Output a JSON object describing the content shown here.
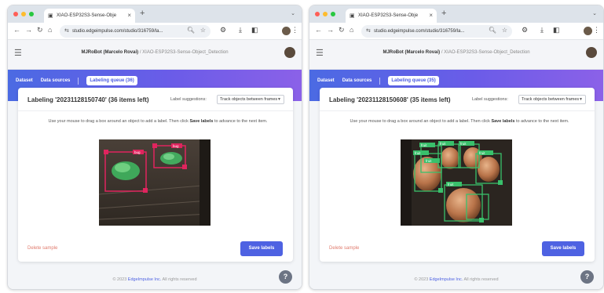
{
  "colors": {
    "brand_blue": "#4e62e2",
    "bbox_red": "#e0245e",
    "bbox_green": "#39c06b",
    "delete_text": "#e07b6d"
  },
  "windows": [
    {
      "tab": {
        "favicon": "edge-impulse-icon",
        "title": "XIAO-ESP32S3-Sense-Obje",
        "close": "×",
        "new_tab": "+"
      },
      "omnibox": {
        "url": "studio.edgeimpulse.com/studio/316759/la..."
      },
      "header": {
        "user": "MJRoBot (Marcelo Rovai)",
        "separator": "/",
        "project": "XIAO-ESP32S3-Sense-Object_Detection"
      },
      "nav": {
        "items": [
          {
            "label": "Dataset"
          },
          {
            "label": "Data sources"
          }
        ],
        "active": "Labeling queue (36)"
      },
      "card": {
        "title": "Labeling '20231128150740' (36 items left)",
        "suggestions_label": "Label suggestions:",
        "suggestions_value": "Track objects between frames",
        "instr_pre": "Use your mouse to drag a box around an object to add a label. Then click ",
        "instr_bold": "Save labels",
        "instr_post": " to advance to the next item.",
        "delete": "Delete sample",
        "save": "Save labels"
      },
      "image": {
        "labels": [
          "bug",
          "bug"
        ]
      },
      "footer": {
        "pre": "© 2023 ",
        "link": "EdgeImpulse Inc.",
        "post": " All rights reserved"
      },
      "help": "?"
    },
    {
      "tab": {
        "favicon": "edge-impulse-icon",
        "title": "XIAO-ESP32S3-Sense-Obje",
        "close": "×",
        "new_tab": "+"
      },
      "omnibox": {
        "url": "studio.edgeimpulse.com/studio/316759/la..."
      },
      "header": {
        "user": "MJRoBot (Marcelo Rovai)",
        "separator": "/",
        "project": "XIAO-ESP32S3-Sense-Object_Detection"
      },
      "nav": {
        "items": [
          {
            "label": "Dataset"
          },
          {
            "label": "Data sources"
          }
        ],
        "active": "Labeling queue (35)"
      },
      "card": {
        "title": "Labeling '20231128150608' (35 items left)",
        "suggestions_label": "Label suggestions:",
        "suggestions_value": "Track objects between frames",
        "instr_pre": "Use your mouse to drag a box around an object to add a label. Then click ",
        "instr_bold": "Save labels",
        "instr_post": " to advance to the next item.",
        "delete": "Delete sample",
        "save": "Save labels"
      },
      "image": {
        "labels": [
          "fruit",
          "fruit",
          "fruit",
          "fruit",
          "fruit",
          "fruit",
          "fruit"
        ]
      },
      "footer": {
        "pre": "© 2023 ",
        "link": "EdgeImpulse Inc.",
        "post": " All rights reserved"
      },
      "help": "?"
    }
  ]
}
